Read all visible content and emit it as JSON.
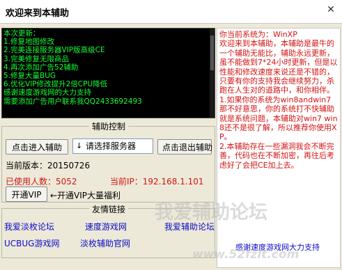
{
  "window": {
    "title": "欢迎来到本辅助",
    "close_glyph": "✕"
  },
  "updates": {
    "lines": [
      "本次更新：",
      "1.修复地图修改",
      "2.完美连接服务器VIP版高级CE",
      "3.完美修复无限商品",
      "4.再次添加广告52辅助",
      "5.修复大量BUG",
      "6.优化VIP修改提升2倍CPU降低",
      "感谢速度游戏网的大力支持",
      "需要添加广告用户联系我QQ2433692493"
    ],
    "text_color": "#15ff35"
  },
  "control": {
    "group_label": "辅助控制",
    "enter_label": "点击进入辅助",
    "server_select": {
      "arrow": "↓",
      "value": "请选择服务器"
    },
    "exit_label": "点击退出辅助",
    "version_text": "当前版本：20150726",
    "users_text": "已使用人数：5052",
    "ip_text": "当前IP：192.168.1.101",
    "vip_label": "开通VIP",
    "vip_hint": "←开通VIP大量福利"
  },
  "friends": {
    "group_label": "友情链接",
    "links": [
      "我爱淡枚论坛",
      "速度游戏网",
      "我爱辅助论坛",
      "UCBUG游戏网",
      "淡枚辅助官网"
    ]
  },
  "notice": {
    "paragraphs": [
      "你当前系统为：WinXP",
      "欢迎来到本辅助，本辅助是最牛的一个辅助无能比，辅助永远更新，虽不能做到7*24小时更新，但是以性能和修改速度来说还是不错的，只要有你的支持我会继续努力，杀跑在人生对的道路中，和你相伴。",
      "1.如果你的系统为win8andwin7那不好意思，你的系统打不快辅助就是系统问题，本辅助对win7 win8还不是很了解，所以推荐你使用XP。",
      "2.本辅助存在一些漏洞我会不断完善，代码也在不断加密，再往后考虑好了会把CE加上去。"
    ],
    "thanks": "感谢速度游戏网大力支持"
  },
  "watermark": {
    "site_name": "我爱辅助论坛",
    "url": "www.52fzlt.com"
  },
  "colors": {
    "accent_red": "#d41414",
    "link_blue": "#0b0bc8",
    "console_bg": "#000000",
    "window_bg": "#ece9d8"
  }
}
